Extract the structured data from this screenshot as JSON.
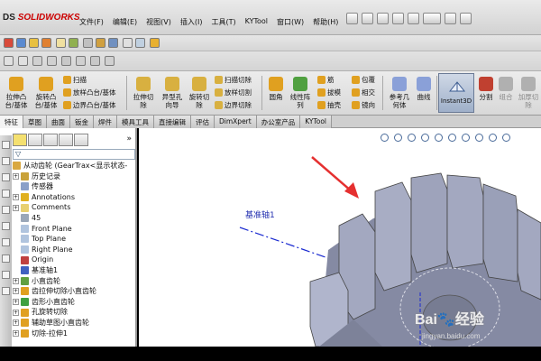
{
  "app": {
    "logo_prefix": "DS",
    "logo_name": "SOLIDWORKS"
  },
  "menu": [
    "文件(F)",
    "编辑(E)",
    "视图(V)",
    "插入(I)",
    "工具(T)",
    "KYTool",
    "窗口(W)",
    "帮助(H)"
  ],
  "command_manager": {
    "extrude_boss": "拉伸凸\n台/基体",
    "revolve_boss": "旋转凸\n台/基体",
    "sweep": "扫描",
    "loft_boss": "放样凸台/基体",
    "boundary_boss": "边界凸台/基体",
    "extrude_cut": "拉伸切\n除",
    "hole_wizard": "异型孔\n向导",
    "revolve_cut": "旋转切\n除",
    "swept_cut": "扫描切除",
    "lofted_cut": "放样切割",
    "boundary_cut": "边界切除",
    "fillet": "圆角",
    "linear_pattern": "线性阵\n列",
    "rib": "筋",
    "draft": "拔模",
    "shell": "抽壳",
    "wrap": "包覆",
    "intersect": "相交",
    "mirror": "镜向",
    "ref_geometry": "参考几\n何体",
    "curves": "曲线",
    "instant3d": "Instant3D",
    "split": "分割",
    "combine": "组合",
    "thicken": "加厚切\n除"
  },
  "tabs": [
    "特征",
    "草图",
    "曲面",
    "钣金",
    "焊件",
    "模具工具",
    "直接编辑",
    "评估",
    "DimXpert",
    "办公室产品",
    "KYTool"
  ],
  "feature_tree": {
    "filter": "▽",
    "expand_symbol": "»",
    "root": "从动齿轮 (GearTrax<显示状态-",
    "items": [
      {
        "label": "历史记录",
        "pm": "+",
        "color": "#c9a23a"
      },
      {
        "label": "传感器",
        "pm": "",
        "color": "#8aa0c8"
      },
      {
        "label": "Annotations",
        "pm": "+",
        "color": "#e0b020"
      },
      {
        "label": "Comments",
        "pm": "+",
        "color": "#e8d070"
      },
      {
        "label": "45",
        "pm": "",
        "color": "#9aa7b8"
      },
      {
        "label": "Front Plane",
        "pm": "",
        "color": "#b0c4de"
      },
      {
        "label": "Top Plane",
        "pm": "",
        "color": "#b0c4de"
      },
      {
        "label": "Right Plane",
        "pm": "",
        "color": "#b0c4de"
      },
      {
        "label": "Origin",
        "pm": "",
        "color": "#c04040"
      },
      {
        "label": "基准轴1",
        "pm": "",
        "color": "#4060c0"
      },
      {
        "label": "小直齿轮",
        "pm": "+",
        "color": "#60a040"
      },
      {
        "label": "齿拉伸切除小直齿轮",
        "pm": "+",
        "color": "#e0a020"
      },
      {
        "label": "齿形小直齿轮",
        "pm": "+",
        "color": "#40a040"
      },
      {
        "label": "孔旋转切除",
        "pm": "+",
        "color": "#e0a020"
      },
      {
        "label": "辅助草图小直齿轮",
        "pm": "+",
        "color": "#e0a020"
      },
      {
        "label": "切除-拉伸1",
        "pm": "+",
        "color": "#e0a020"
      }
    ]
  },
  "viewport": {
    "axis_label": "基准轴1",
    "gear_color": "#9aa0b8"
  },
  "watermark": {
    "brand": "Bai",
    "brand2": "经验",
    "url": "jingyan.baidu.com"
  }
}
